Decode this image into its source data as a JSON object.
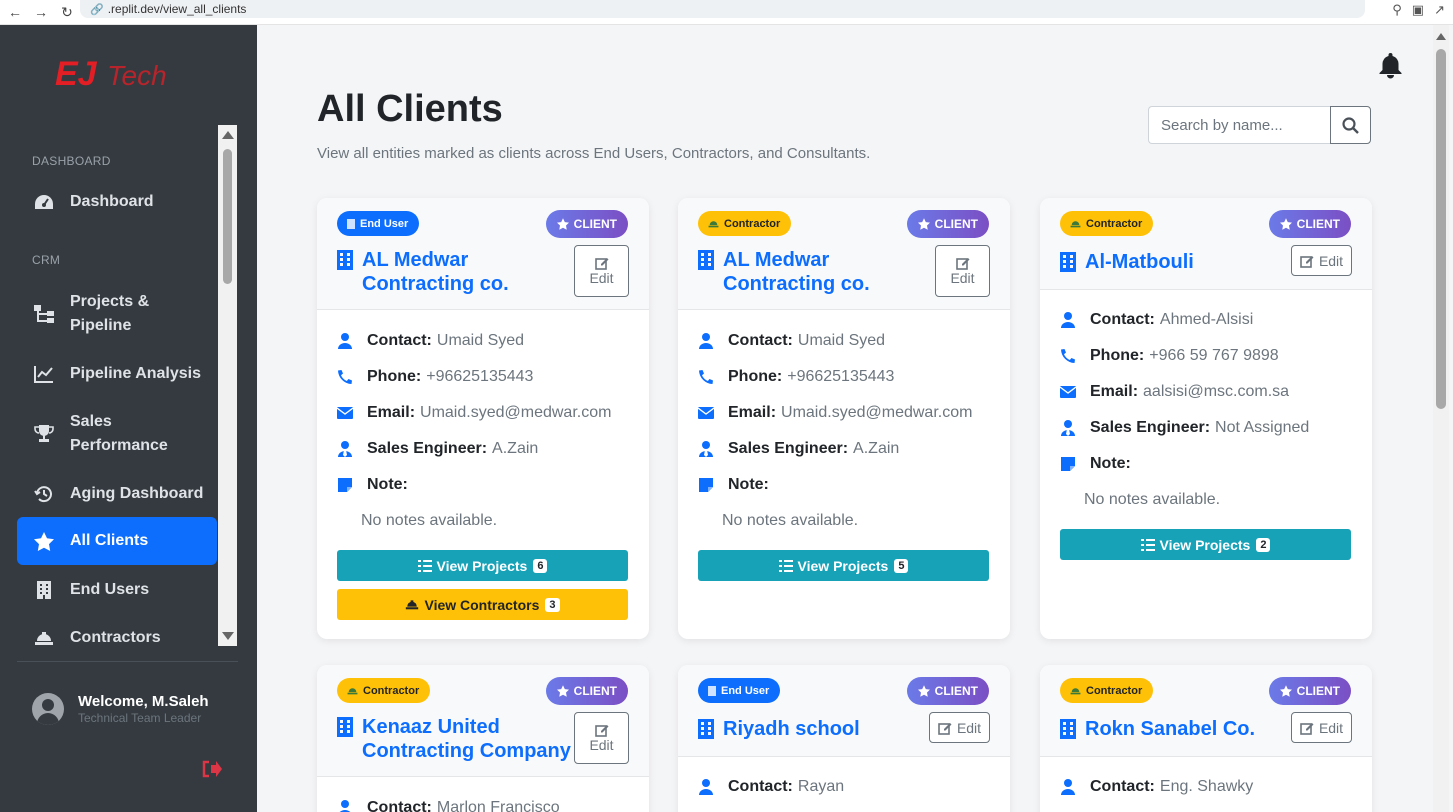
{
  "browser": {
    "url": ".replit.dev/view_all_clients"
  },
  "sidebar": {
    "logo_text": "EJTech",
    "sections": {
      "dashboard": "DASHBOARD",
      "crm": "CRM"
    },
    "items": [
      {
        "label": "Dashboard",
        "icon": "gauge-icon"
      },
      {
        "label": "Projects & Pipeline",
        "icon": "sitemap-icon"
      },
      {
        "label": "Pipeline Analysis",
        "icon": "chart-line-icon"
      },
      {
        "label": "Sales Performance",
        "icon": "trophy-icon"
      },
      {
        "label": "Aging Dashboard",
        "icon": "history-icon"
      },
      {
        "label": "All Clients",
        "icon": "star-icon",
        "active": true
      },
      {
        "label": "End Users",
        "icon": "building-icon"
      },
      {
        "label": "Contractors",
        "icon": "hard-hat-icon"
      }
    ],
    "user": {
      "welcome": "Welcome, M.Saleh",
      "role": "Technical Team Leader"
    }
  },
  "main": {
    "title": "All Clients",
    "subtitle": "View all entities marked as clients across End Users, Contractors, and Consultants.",
    "search_placeholder": "Search by name..."
  },
  "labels": {
    "client": "CLIENT",
    "edit": "Edit",
    "contact": "Contact:",
    "phone": "Phone:",
    "email": "Email:",
    "sales_engineer": "Sales Engineer:",
    "note": "Note:",
    "no_notes": "No notes available.",
    "view_projects": "View Projects",
    "view_contractors": "View Contractors"
  },
  "cards": [
    {
      "type": "End User",
      "name_line1": "AL Medwar",
      "name_line2": "Contracting co.",
      "contact": "Umaid Syed",
      "phone": "+96625135443",
      "email": "Umaid.syed@medwar.com",
      "sales_engineer": "A.Zain",
      "projects": "6",
      "contractors": "3"
    },
    {
      "type": "Contractor",
      "name_line1": "AL Medwar",
      "name_line2": "Contracting co.",
      "contact": "Umaid Syed",
      "phone": "+96625135443",
      "email": "Umaid.syed@medwar.com",
      "sales_engineer": "A.Zain",
      "projects": "5"
    },
    {
      "type": "Contractor",
      "name_line1": "Al-Matbouli",
      "contact": "Ahmed-Alsisi",
      "phone": "+966 59 767 9898",
      "email": "aalsisi@msc.com.sa",
      "sales_engineer": "Not Assigned",
      "projects": "2"
    },
    {
      "type": "Contractor",
      "name_line1": "Kenaaz United",
      "name_line2": "Contracting Company",
      "contact": "Marlon Francisco"
    },
    {
      "type": "End User",
      "name_line1": "Riyadh school",
      "contact": "Rayan"
    },
    {
      "type": "Contractor",
      "name_line1": "Rokn Sanabel Co.",
      "contact": "Eng. Shawky"
    }
  ],
  "colors": {
    "primary": "#0d6efd",
    "info": "#17a2b8",
    "warning": "#ffc107",
    "sidebar": "#343a40"
  }
}
